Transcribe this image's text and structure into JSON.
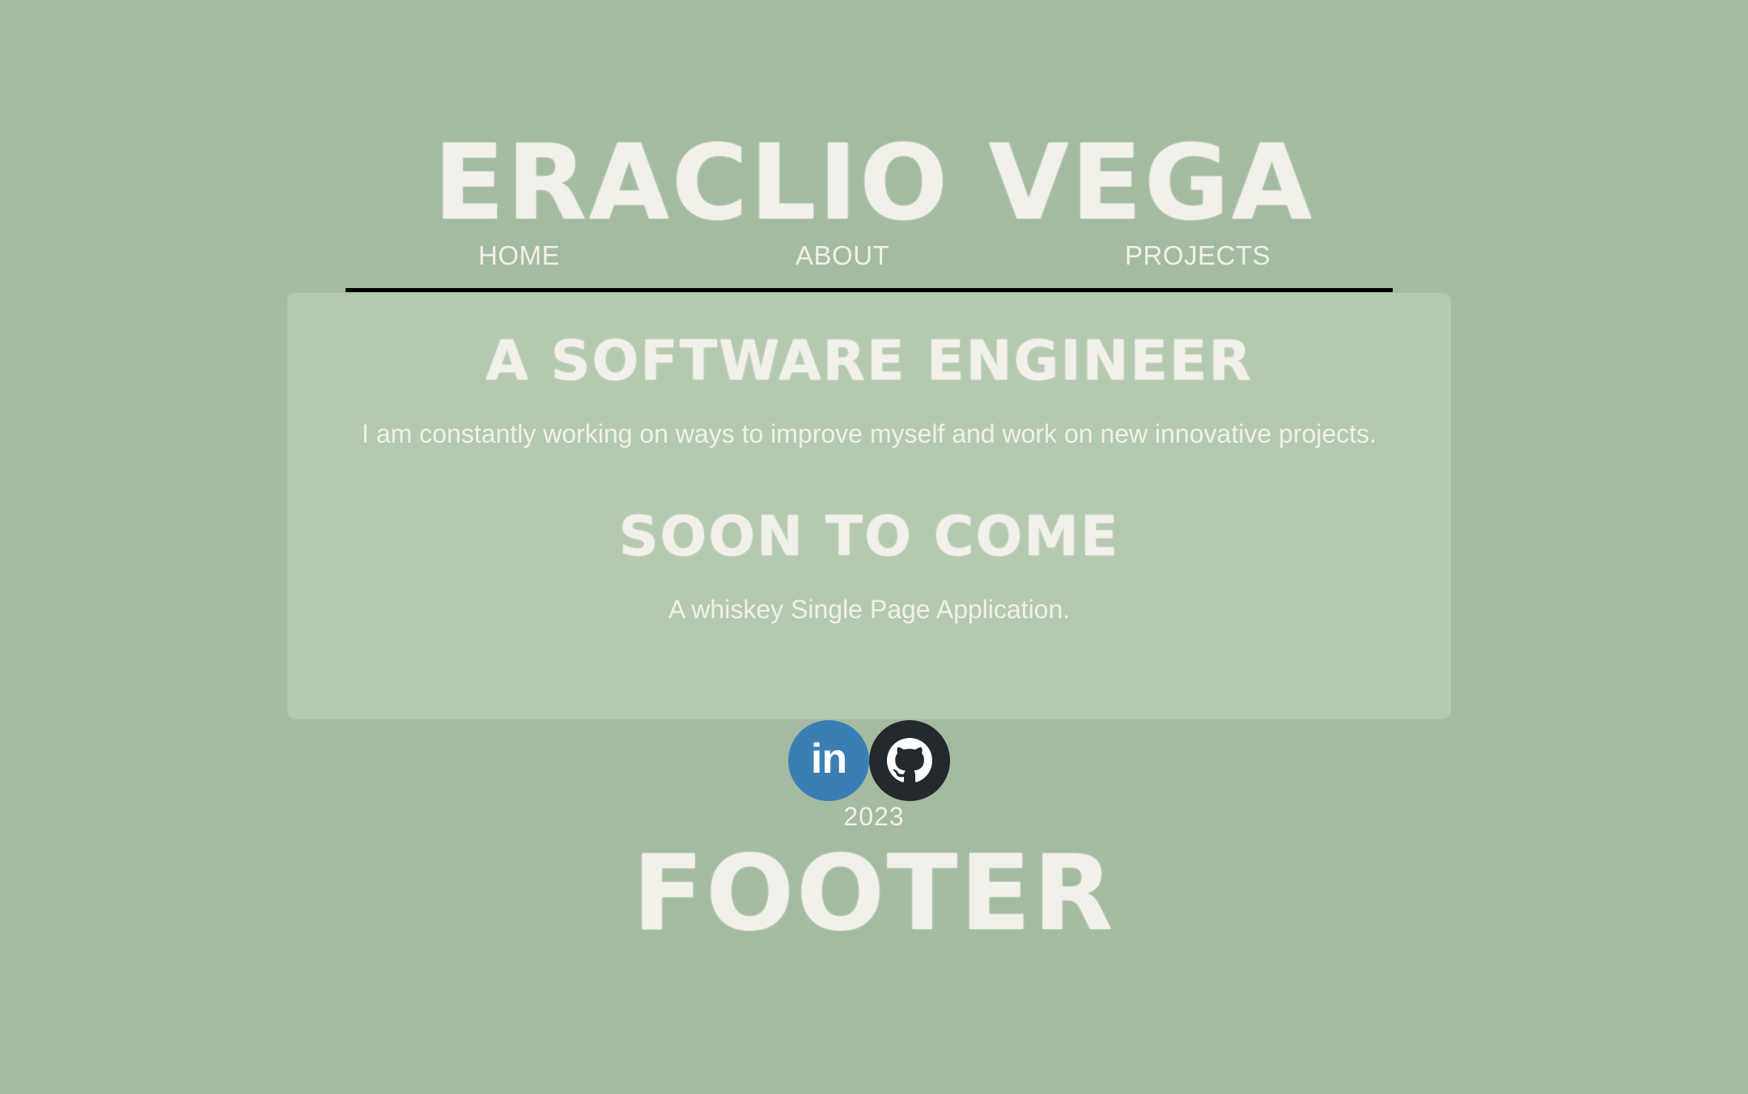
{
  "header": {
    "title": "ERACLIO VEGA"
  },
  "nav": {
    "items": [
      {
        "label": "HOME"
      },
      {
        "label": "ABOUT"
      },
      {
        "label": "PROJECTS"
      }
    ]
  },
  "main": {
    "sections": [
      {
        "heading": "A SOFTWARE ENGINEER",
        "text": "I am constantly working on ways to improve myself and work on new innovative projects."
      },
      {
        "heading": "SOON TO COME",
        "text": "A whiskey Single Page Application."
      }
    ]
  },
  "social": {
    "links": [
      {
        "icon": "linkedin-icon",
        "glyph": "in",
        "color": "#3a7fb3"
      },
      {
        "icon": "github-icon",
        "color": "#24292e"
      }
    ]
  },
  "footer": {
    "year": "2023",
    "title": "FOOTER"
  },
  "colors": {
    "background": "#a4bba2",
    "card": "#b4c9b0",
    "text": "#f2f0ea",
    "nav_rule": "#000000"
  }
}
